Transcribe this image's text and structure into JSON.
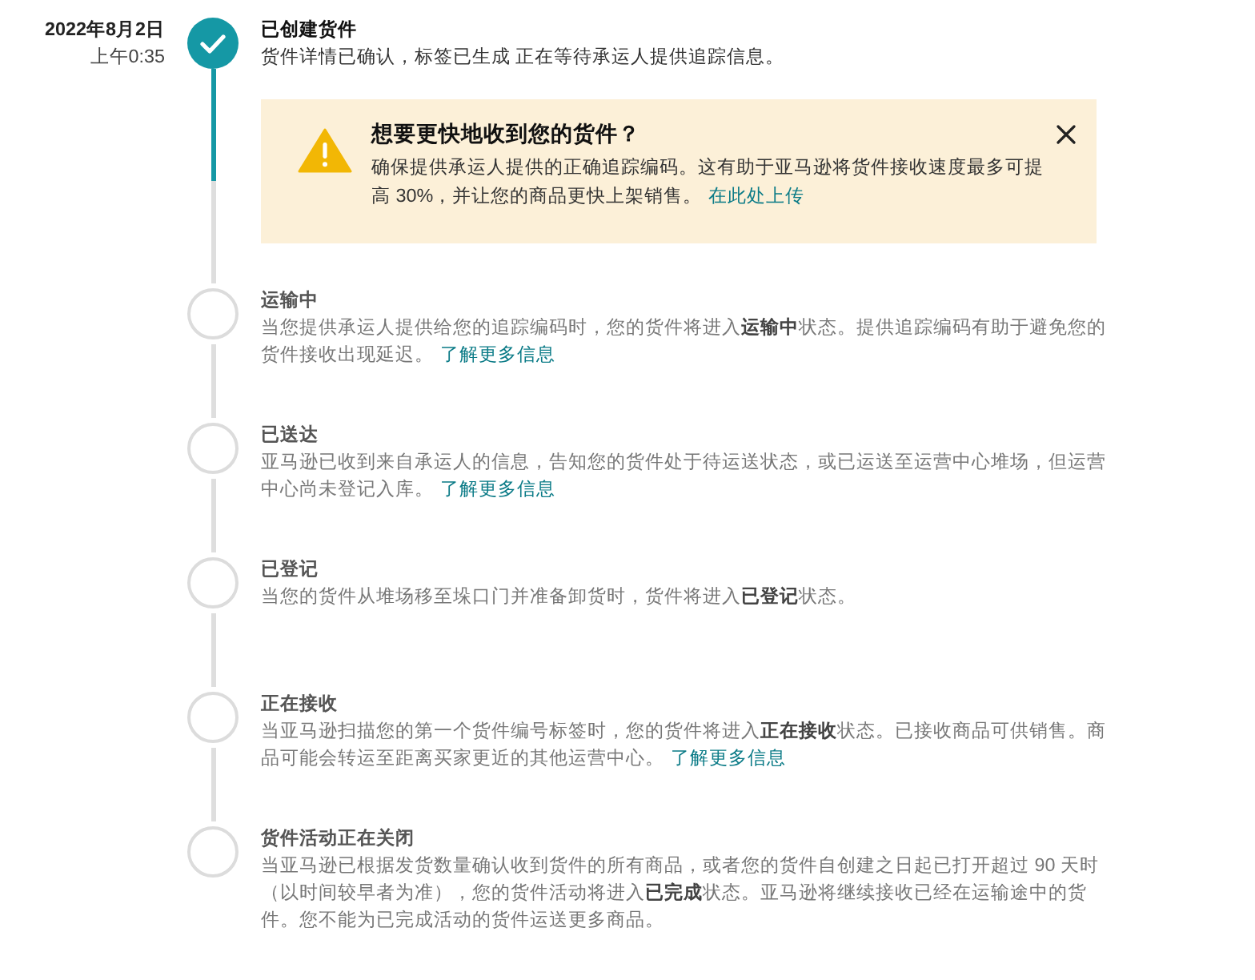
{
  "timeline": {
    "steps": [
      {
        "date": "2022年8月2日",
        "time": "上午0:35",
        "title": "已创建货件",
        "description": "货件详情已确认，标签已生成 正在等待承运人提供追踪信息。",
        "completed": true,
        "alert": {
          "title": "想要更快地收到您的货件？",
          "text": "确保提供承运人提供的正确追踪编码。这有助于亚马逊将货件接收速度最多可提高 30%，并让您的商品更快上架销售。",
          "link": "在此处上传"
        }
      },
      {
        "title": "运输中",
        "description": "当您提供承运人提供给您的追踪编码时，您的货件将进入**运输中**状态。提供追踪编码有助于避免您的货件接收出现延迟。",
        "link": "了解更多信息",
        "completed": false
      },
      {
        "title": "已送达",
        "description": "亚马逊已收到来自承运人的信息，告知您的货件处于待运送状态，或已运送至运营中心堆场，但运营中心尚未登记入库。",
        "link": "了解更多信息",
        "completed": false
      },
      {
        "title": "已登记",
        "description": "当您的货件从堆场移至垛口门并准备卸货时，货件将进入**已登记**状态。",
        "completed": false
      },
      {
        "title": "正在接收",
        "description": "当亚马逊扫描您的第一个货件编号标签时，您的货件将进入**正在接收**状态。已接收商品可供销售。商品可能会转运至距离买家更近的其他运营中心。",
        "link": "了解更多信息",
        "completed": false
      },
      {
        "title": "货件活动正在关闭",
        "description": "当亚马逊已根据发货数量确认收到货件的所有商品，或者您的货件自创建之日起已打开超过 90 天时（以时间较早者为准），您的货件活动将进入**已完成**状态。亚马逊将继续接收已经在运输途中的货件。您不能为已完成活动的货件运送更多商品。",
        "completed": false
      }
    ]
  }
}
